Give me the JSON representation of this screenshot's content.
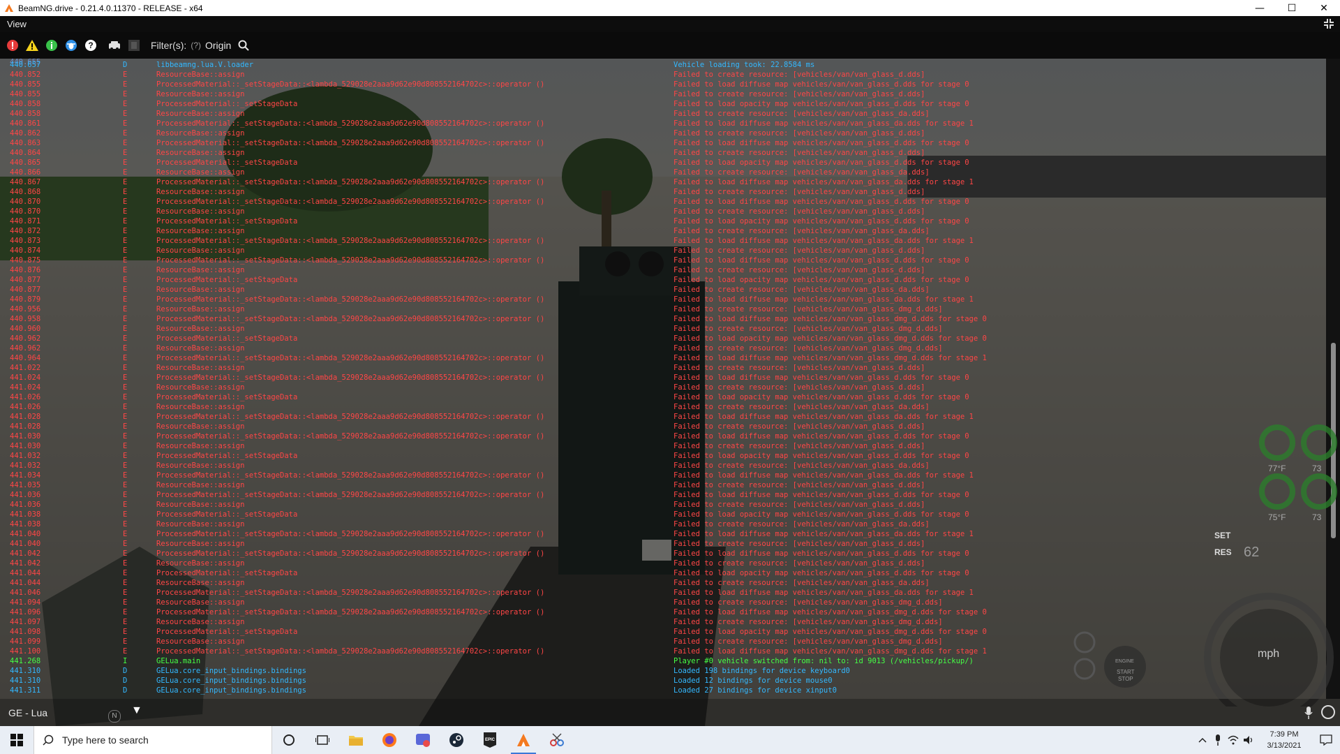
{
  "window": {
    "title": "BeamNG.drive - 0.21.4.0.11370 - RELEASE - x64",
    "controls": {
      "minimize": "—",
      "maximize": "☐",
      "close": "✕"
    }
  },
  "menu": {
    "view_label": "View"
  },
  "toolbar": {
    "filter_label": "Filter(s):",
    "filter_help": "(?)",
    "origin_label": "Origin",
    "icons": [
      "error-filter-icon",
      "warning-filter-icon",
      "info-filter-icon",
      "debug-filter-icon",
      "help-filter-icon",
      "vehicle-filter-icon",
      "grey-filter-icon",
      "search-icon"
    ]
  },
  "log": {
    "partial_top_time": "440.655",
    "entries": [
      {
        "time": "440.657",
        "level": "D",
        "origin": "libbeamng.lua.V.loader",
        "message": "Vehicle loading took: 22.8584 ms"
      },
      {
        "time": "440.852",
        "level": "E",
        "origin": "ResourceBase::assign",
        "message": "Failed to create resource: [vehicles/van/van_glass_d.dds]"
      },
      {
        "time": "440.855",
        "level": "E",
        "origin": "ProcessedMaterial::_setStageData::<lambda_529028e2aaa9d62e90d808552164702c>::operator ()",
        "message": "Failed to load diffuse map vehicles/van/van_glass_d.dds for stage 0"
      },
      {
        "time": "440.855",
        "level": "E",
        "origin": "ResourceBase::assign",
        "message": "Failed to create resource: [vehicles/van/van_glass_d.dds]"
      },
      {
        "time": "440.858",
        "level": "E",
        "origin": "ProcessedMaterial::_setStageData",
        "message": "Failed to load opacity map vehicles/van/van_glass_d.dds for stage 0"
      },
      {
        "time": "440.858",
        "level": "E",
        "origin": "ResourceBase::assign",
        "message": "Failed to create resource: [vehicles/van/van_glass_da.dds]"
      },
      {
        "time": "440.861",
        "level": "E",
        "origin": "ProcessedMaterial::_setStageData::<lambda_529028e2aaa9d62e90d808552164702c>::operator ()",
        "message": "Failed to load diffuse map vehicles/van/van_glass_da.dds for stage 1"
      },
      {
        "time": "440.862",
        "level": "E",
        "origin": "ResourceBase::assign",
        "message": "Failed to create resource: [vehicles/van/van_glass_d.dds]"
      },
      {
        "time": "440.863",
        "level": "E",
        "origin": "ProcessedMaterial::_setStageData::<lambda_529028e2aaa9d62e90d808552164702c>::operator ()",
        "message": "Failed to load diffuse map vehicles/van/van_glass_d.dds for stage 0"
      },
      {
        "time": "440.864",
        "level": "E",
        "origin": "ResourceBase::assign",
        "message": "Failed to create resource: [vehicles/van/van_glass_d.dds]"
      },
      {
        "time": "440.865",
        "level": "E",
        "origin": "ProcessedMaterial::_setStageData",
        "message": "Failed to load opacity map vehicles/van/van_glass_d.dds for stage 0"
      },
      {
        "time": "440.866",
        "level": "E",
        "origin": "ResourceBase::assign",
        "message": "Failed to create resource: [vehicles/van/van_glass_da.dds]"
      },
      {
        "time": "440.867",
        "level": "E",
        "origin": "ProcessedMaterial::_setStageData::<lambda_529028e2aaa9d62e90d808552164702c>::operator ()",
        "message": "Failed to load diffuse map vehicles/van/van_glass_da.dds for stage 1"
      },
      {
        "time": "440.868",
        "level": "E",
        "origin": "ResourceBase::assign",
        "message": "Failed to create resource: [vehicles/van/van_glass_d.dds]"
      },
      {
        "time": "440.870",
        "level": "E",
        "origin": "ProcessedMaterial::_setStageData::<lambda_529028e2aaa9d62e90d808552164702c>::operator ()",
        "message": "Failed to load diffuse map vehicles/van/van_glass_d.dds for stage 0"
      },
      {
        "time": "440.870",
        "level": "E",
        "origin": "ResourceBase::assign",
        "message": "Failed to create resource: [vehicles/van/van_glass_d.dds]"
      },
      {
        "time": "440.871",
        "level": "E",
        "origin": "ProcessedMaterial::_setStageData",
        "message": "Failed to load opacity map vehicles/van/van_glass_d.dds for stage 0"
      },
      {
        "time": "440.872",
        "level": "E",
        "origin": "ResourceBase::assign",
        "message": "Failed to create resource: [vehicles/van/van_glass_da.dds]"
      },
      {
        "time": "440.873",
        "level": "E",
        "origin": "ProcessedMaterial::_setStageData::<lambda_529028e2aaa9d62e90d808552164702c>::operator ()",
        "message": "Failed to load diffuse map vehicles/van/van_glass_da.dds for stage 1"
      },
      {
        "time": "440.874",
        "level": "E",
        "origin": "ResourceBase::assign",
        "message": "Failed to create resource: [vehicles/van/van_glass_d.dds]"
      },
      {
        "time": "440.875",
        "level": "E",
        "origin": "ProcessedMaterial::_setStageData::<lambda_529028e2aaa9d62e90d808552164702c>::operator ()",
        "message": "Failed to load diffuse map vehicles/van/van_glass_d.dds for stage 0"
      },
      {
        "time": "440.876",
        "level": "E",
        "origin": "ResourceBase::assign",
        "message": "Failed to create resource: [vehicles/van/van_glass_d.dds]"
      },
      {
        "time": "440.877",
        "level": "E",
        "origin": "ProcessedMaterial::_setStageData",
        "message": "Failed to load opacity map vehicles/van/van_glass_d.dds for stage 0"
      },
      {
        "time": "440.877",
        "level": "E",
        "origin": "ResourceBase::assign",
        "message": "Failed to create resource: [vehicles/van/van_glass_da.dds]"
      },
      {
        "time": "440.879",
        "level": "E",
        "origin": "ProcessedMaterial::_setStageData::<lambda_529028e2aaa9d62e90d808552164702c>::operator ()",
        "message": "Failed to load diffuse map vehicles/van/van_glass_da.dds for stage 1"
      },
      {
        "time": "440.956",
        "level": "E",
        "origin": "ResourceBase::assign",
        "message": "Failed to create resource: [vehicles/van/van_glass_dmg_d.dds]"
      },
      {
        "time": "440.958",
        "level": "E",
        "origin": "ProcessedMaterial::_setStageData::<lambda_529028e2aaa9d62e90d808552164702c>::operator ()",
        "message": "Failed to load diffuse map vehicles/van/van_glass_dmg_d.dds for stage 0"
      },
      {
        "time": "440.960",
        "level": "E",
        "origin": "ResourceBase::assign",
        "message": "Failed to create resource: [vehicles/van/van_glass_dmg_d.dds]"
      },
      {
        "time": "440.962",
        "level": "E",
        "origin": "ProcessedMaterial::_setStageData",
        "message": "Failed to load opacity map vehicles/van/van_glass_dmg_d.dds for stage 0"
      },
      {
        "time": "440.962",
        "level": "E",
        "origin": "ResourceBase::assign",
        "message": "Failed to create resource: [vehicles/van/van_glass_dmg_d.dds]"
      },
      {
        "time": "440.964",
        "level": "E",
        "origin": "ProcessedMaterial::_setStageData::<lambda_529028e2aaa9d62e90d808552164702c>::operator ()",
        "message": "Failed to load diffuse map vehicles/van/van_glass_dmg_d.dds for stage 1"
      },
      {
        "time": "441.022",
        "level": "E",
        "origin": "ResourceBase::assign",
        "message": "Failed to create resource: [vehicles/van/van_glass_d.dds]"
      },
      {
        "time": "441.024",
        "level": "E",
        "origin": "ProcessedMaterial::_setStageData::<lambda_529028e2aaa9d62e90d808552164702c>::operator ()",
        "message": "Failed to load diffuse map vehicles/van/van_glass_d.dds for stage 0"
      },
      {
        "time": "441.024",
        "level": "E",
        "origin": "ResourceBase::assign",
        "message": "Failed to create resource: [vehicles/van/van_glass_d.dds]"
      },
      {
        "time": "441.026",
        "level": "E",
        "origin": "ProcessedMaterial::_setStageData",
        "message": "Failed to load opacity map vehicles/van/van_glass_d.dds for stage 0"
      },
      {
        "time": "441.026",
        "level": "E",
        "origin": "ResourceBase::assign",
        "message": "Failed to create resource: [vehicles/van/van_glass_da.dds]"
      },
      {
        "time": "441.028",
        "level": "E",
        "origin": "ProcessedMaterial::_setStageData::<lambda_529028e2aaa9d62e90d808552164702c>::operator ()",
        "message": "Failed to load diffuse map vehicles/van/van_glass_da.dds for stage 1"
      },
      {
        "time": "441.028",
        "level": "E",
        "origin": "ResourceBase::assign",
        "message": "Failed to create resource: [vehicles/van/van_glass_d.dds]"
      },
      {
        "time": "441.030",
        "level": "E",
        "origin": "ProcessedMaterial::_setStageData::<lambda_529028e2aaa9d62e90d808552164702c>::operator ()",
        "message": "Failed to load diffuse map vehicles/van/van_glass_d.dds for stage 0"
      },
      {
        "time": "441.030",
        "level": "E",
        "origin": "ResourceBase::assign",
        "message": "Failed to create resource: [vehicles/van/van_glass_d.dds]"
      },
      {
        "time": "441.032",
        "level": "E",
        "origin": "ProcessedMaterial::_setStageData",
        "message": "Failed to load opacity map vehicles/van/van_glass_d.dds for stage 0"
      },
      {
        "time": "441.032",
        "level": "E",
        "origin": "ResourceBase::assign",
        "message": "Failed to create resource: [vehicles/van/van_glass_da.dds]"
      },
      {
        "time": "441.034",
        "level": "E",
        "origin": "ProcessedMaterial::_setStageData::<lambda_529028e2aaa9d62e90d808552164702c>::operator ()",
        "message": "Failed to load diffuse map vehicles/van/van_glass_da.dds for stage 1"
      },
      {
        "time": "441.035",
        "level": "E",
        "origin": "ResourceBase::assign",
        "message": "Failed to create resource: [vehicles/van/van_glass_d.dds]"
      },
      {
        "time": "441.036",
        "level": "E",
        "origin": "ProcessedMaterial::_setStageData::<lambda_529028e2aaa9d62e90d808552164702c>::operator ()",
        "message": "Failed to load diffuse map vehicles/van/van_glass_d.dds for stage 0"
      },
      {
        "time": "441.036",
        "level": "E",
        "origin": "ResourceBase::assign",
        "message": "Failed to create resource: [vehicles/van/van_glass_d.dds]"
      },
      {
        "time": "441.038",
        "level": "E",
        "origin": "ProcessedMaterial::_setStageData",
        "message": "Failed to load opacity map vehicles/van/van_glass_d.dds for stage 0"
      },
      {
        "time": "441.038",
        "level": "E",
        "origin": "ResourceBase::assign",
        "message": "Failed to create resource: [vehicles/van/van_glass_da.dds]"
      },
      {
        "time": "441.040",
        "level": "E",
        "origin": "ProcessedMaterial::_setStageData::<lambda_529028e2aaa9d62e90d808552164702c>::operator ()",
        "message": "Failed to load diffuse map vehicles/van/van_glass_da.dds for stage 1"
      },
      {
        "time": "441.040",
        "level": "E",
        "origin": "ResourceBase::assign",
        "message": "Failed to create resource: [vehicles/van/van_glass_d.dds]"
      },
      {
        "time": "441.042",
        "level": "E",
        "origin": "ProcessedMaterial::_setStageData::<lambda_529028e2aaa9d62e90d808552164702c>::operator ()",
        "message": "Failed to load diffuse map vehicles/van/van_glass_d.dds for stage 0"
      },
      {
        "time": "441.042",
        "level": "E",
        "origin": "ResourceBase::assign",
        "message": "Failed to create resource: [vehicles/van/van_glass_d.dds]"
      },
      {
        "time": "441.044",
        "level": "E",
        "origin": "ProcessedMaterial::_setStageData",
        "message": "Failed to load opacity map vehicles/van/van_glass_d.dds for stage 0"
      },
      {
        "time": "441.044",
        "level": "E",
        "origin": "ResourceBase::assign",
        "message": "Failed to create resource: [vehicles/van/van_glass_da.dds]"
      },
      {
        "time": "441.046",
        "level": "E",
        "origin": "ProcessedMaterial::_setStageData::<lambda_529028e2aaa9d62e90d808552164702c>::operator ()",
        "message": "Failed to load diffuse map vehicles/van/van_glass_da.dds for stage 1"
      },
      {
        "time": "441.094",
        "level": "E",
        "origin": "ResourceBase::assign",
        "message": "Failed to create resource: [vehicles/van/van_glass_dmg_d.dds]"
      },
      {
        "time": "441.096",
        "level": "E",
        "origin": "ProcessedMaterial::_setStageData::<lambda_529028e2aaa9d62e90d808552164702c>::operator ()",
        "message": "Failed to load diffuse map vehicles/van/van_glass_dmg_d.dds for stage 0"
      },
      {
        "time": "441.097",
        "level": "E",
        "origin": "ResourceBase::assign",
        "message": "Failed to create resource: [vehicles/van/van_glass_dmg_d.dds]"
      },
      {
        "time": "441.098",
        "level": "E",
        "origin": "ProcessedMaterial::_setStageData",
        "message": "Failed to load opacity map vehicles/van/van_glass_dmg_d.dds for stage 0"
      },
      {
        "time": "441.099",
        "level": "E",
        "origin": "ResourceBase::assign",
        "message": "Failed to create resource: [vehicles/van/van_glass_dmg_d.dds]"
      },
      {
        "time": "441.100",
        "level": "E",
        "origin": "ProcessedMaterial::_setStageData::<lambda_529028e2aaa9d62e90d808552164702c>::operator ()",
        "message": "Failed to load diffuse map vehicles/van/van_glass_dmg_d.dds for stage 1"
      },
      {
        "time": "441.268",
        "level": "I",
        "origin": "GELua.main",
        "message": "Player #0 vehicle switched from: nil to: id 9013 (/vehicles/pickup/)"
      },
      {
        "time": "441.310",
        "level": "D",
        "origin": "GELua.core_input_bindings.bindings",
        "message": "Loaded 198 bindings for device keyboard0"
      },
      {
        "time": "441.310",
        "level": "D",
        "origin": "GELua.core_input_bindings.bindings",
        "message": "Loaded 12 bindings for device mouse0"
      },
      {
        "time": "441.311",
        "level": "D",
        "origin": "GELua.core_input_bindings.bindings",
        "message": "Loaded 27 bindings for device xinput0"
      }
    ]
  },
  "bottom": {
    "context_label": "GE - Lua",
    "context_arrow": "▼",
    "n_badge": "N"
  },
  "hud": {
    "temp_1": "77°F",
    "temp_2": "73",
    "temp_3": "75°F",
    "temp_4": "73",
    "set_label": "SET",
    "res_label": "RES",
    "speed_target": "62",
    "gauge_unit": "mph",
    "gauge_start": "START",
    "gauge_stop": "STOP",
    "gauge_engine": "ENGINE"
  },
  "taskbar": {
    "search_placeholder": "Type here to search",
    "time": "7:39 PM",
    "date": "3/13/2021"
  },
  "colors": {
    "error": "#ff4646",
    "debug": "#33b8ff",
    "info": "#45ff45",
    "console_bg": "#0b0b0b",
    "taskbar_bg": "#e9eef5"
  }
}
